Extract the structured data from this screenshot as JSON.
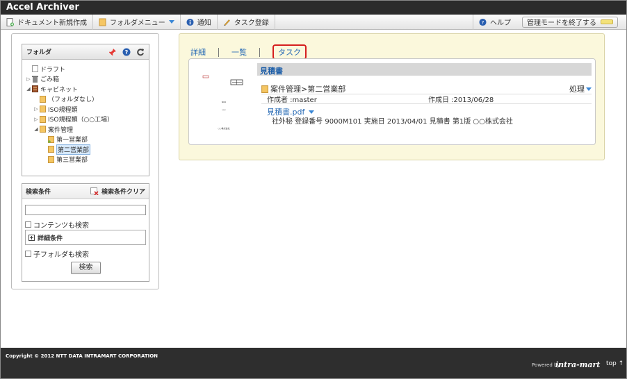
{
  "app": {
    "title": "Accel Archiver"
  },
  "toolbar": {
    "new_doc": "ドキュメント新規作成",
    "folder_menu": "フォルダメニュー",
    "notice": "通知",
    "task_register": "タスク登録",
    "help": "ヘルプ",
    "exit_admin": "管理モードを終了する"
  },
  "folder_panel": {
    "title": "フォルダ",
    "items": [
      {
        "label": "ドラフト"
      },
      {
        "label": "ごみ箱"
      },
      {
        "label": "キャビネット"
      },
      {
        "label": "（フォルダなし）"
      },
      {
        "label": "ISO規程類"
      },
      {
        "label": "ISO規程類（○○工場）"
      },
      {
        "label": "案件管理"
      },
      {
        "label": "第一営業部"
      },
      {
        "label": "第二営業部"
      },
      {
        "label": "第三営業部"
      }
    ]
  },
  "search_panel": {
    "title": "検索条件",
    "clear": "検索条件クリア",
    "query": "",
    "content_search": "コンテンツも検索",
    "detail": "詳細条件",
    "subfolder_search": "子フォルダも検索",
    "search_button": "検索"
  },
  "tabs": {
    "detail": "詳細",
    "list": "一覧",
    "task": "タスク"
  },
  "document": {
    "title": "見積書",
    "path": "案件管理>第二営業部",
    "action": "処理",
    "author": "作成者 :master",
    "created": "作成日 :2013/06/28",
    "file": "見積書.pdf",
    "description": "社外秘  登録番号 9000M101  実施日 2013/04/01 見積書 第1版 ○○株式会社",
    "thumb_text_1": "NO0",
    "thumb_text_2": "○○",
    "thumb_text_3": "○○株式会社"
  },
  "footer": {
    "copyright": "Copyright © 2012 NTT DATA INTRAMART CORPORATION",
    "powered": "Powered by",
    "logo": "intra-mart",
    "top": "top ↑"
  },
  "colors": {
    "accent": "#2a6cb6",
    "header_bg": "#2b2b2b",
    "panel_bg": "#fbf8dc",
    "highlight": "#d51e1e"
  }
}
